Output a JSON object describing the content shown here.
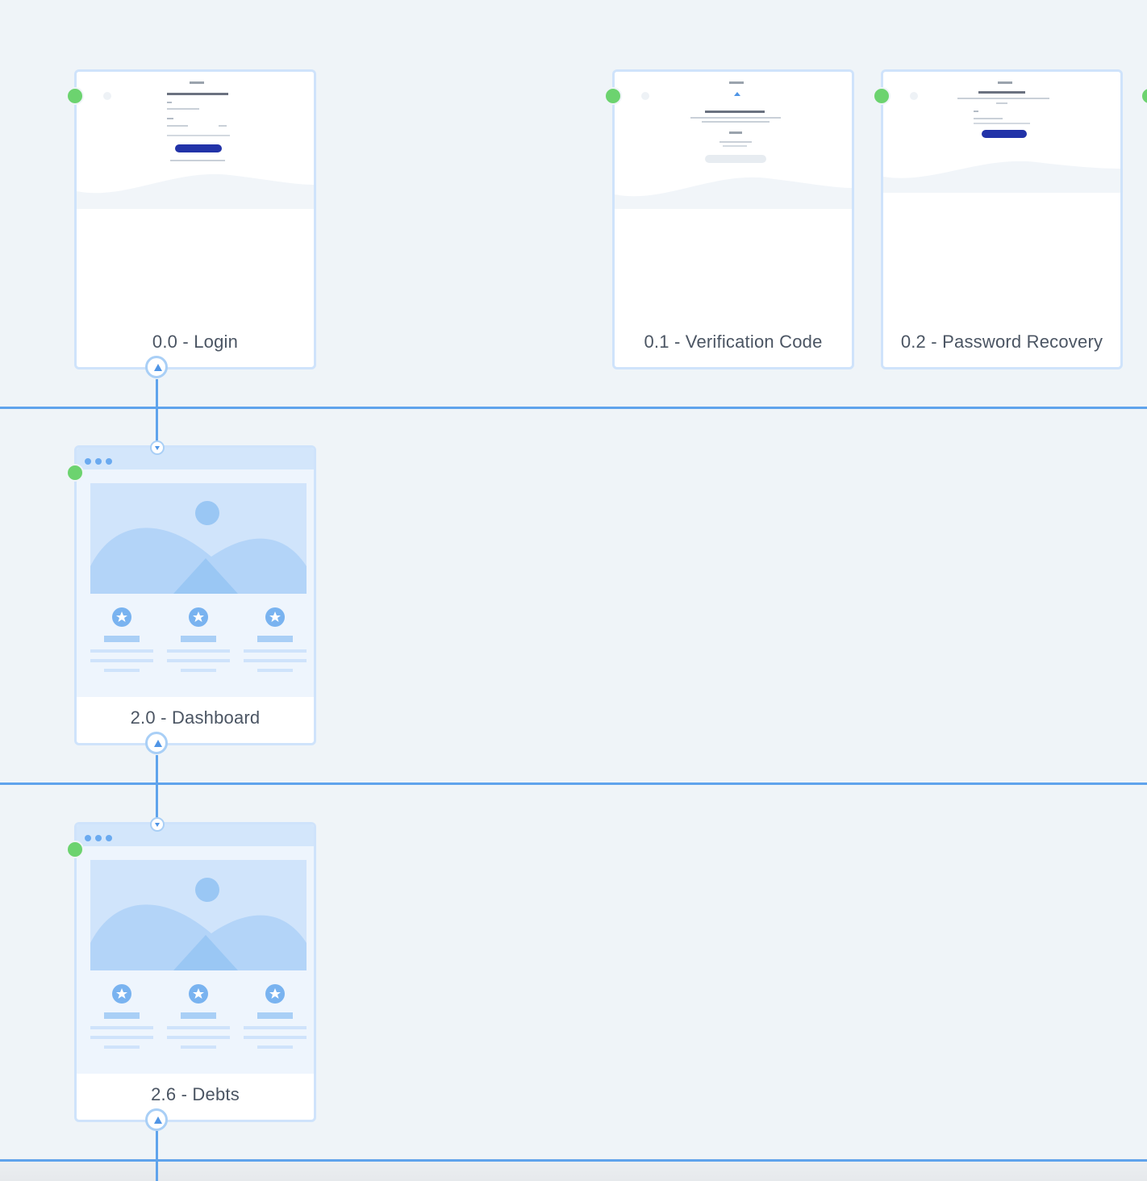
{
  "screens": [
    {
      "id": "login",
      "label": "0.0 - Login",
      "type": "login"
    },
    {
      "id": "verification",
      "label": "0.1 - Verification Code",
      "type": "login"
    },
    {
      "id": "password-recovery",
      "label": "0.2 - Password Recovery",
      "type": "login"
    },
    {
      "id": "dashboard",
      "label": "2.0 - Dashboard",
      "type": "wireframe"
    },
    {
      "id": "debts",
      "label": "2.6 - Debts",
      "type": "wireframe"
    }
  ],
  "colors": {
    "canvas": "#eff4f8",
    "flow_line": "#5fa3ec",
    "card_border": "#cfe3fb",
    "start_marker": "#6cd36f",
    "button": "#2233a8"
  },
  "icons": [
    "start-marker",
    "expand-up-icon",
    "collapse-down-icon",
    "star-icon",
    "image-placeholder-icon"
  ]
}
